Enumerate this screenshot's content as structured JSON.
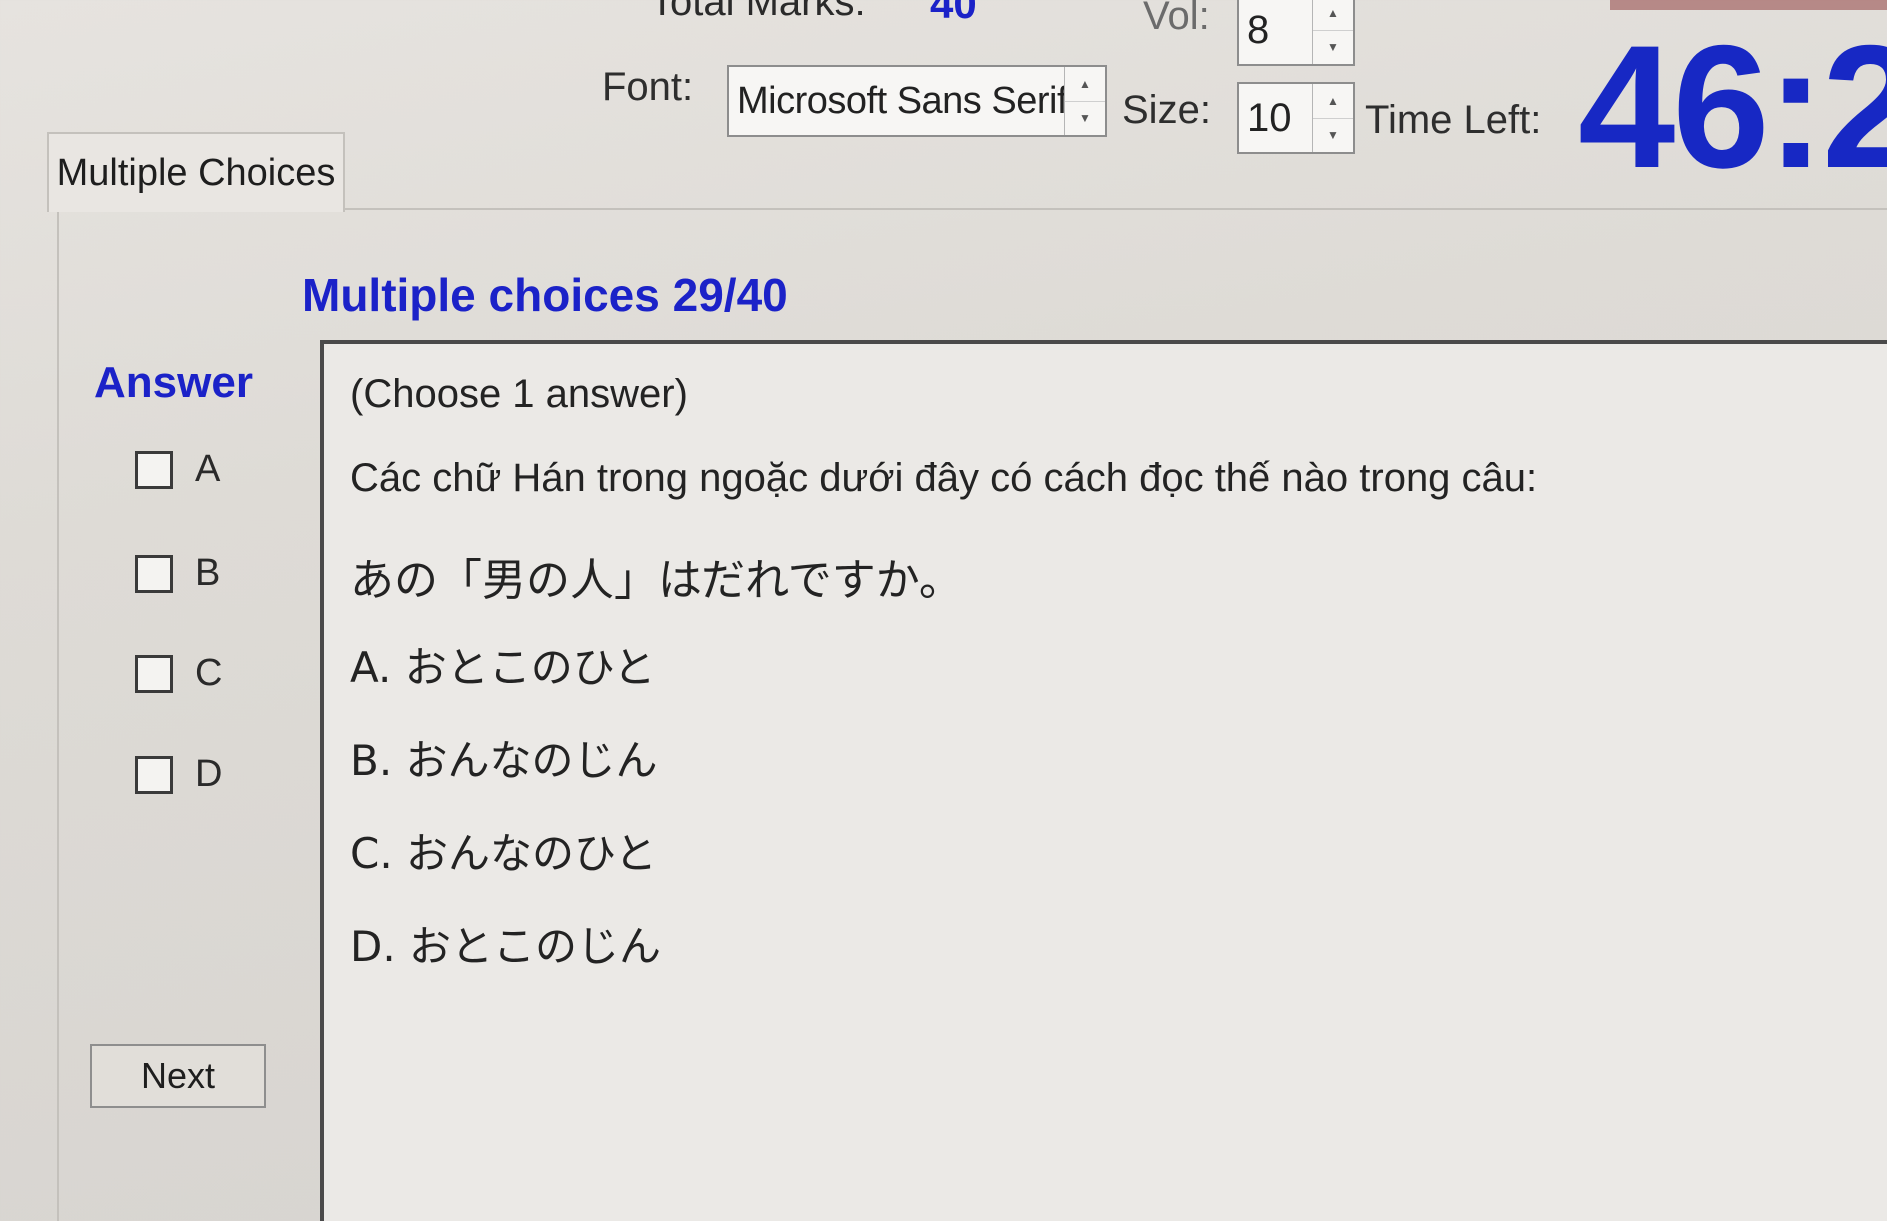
{
  "header": {
    "total_marks_label": "Total Marks:",
    "total_marks_value": "40",
    "vol_label": "Vol:",
    "vol_value": "8",
    "font_label": "Font:",
    "font_value": "Microsoft Sans Serif",
    "size_label": "Size:",
    "size_value": "10",
    "time_left_label": "Time Left:",
    "time_left_value": "46:2"
  },
  "tabs": [
    {
      "label": "Multiple Choices",
      "active": true
    }
  ],
  "question": {
    "progress": "Multiple choices 29/40",
    "instruction": "(Choose 1 answer)",
    "text": "Các chữ Hán trong ngoặc dưới đây có cách đọc thế nào trong câu:",
    "sentence": "あの「男の人」はだれですか。",
    "options": [
      "A. おとこのひと",
      "B. おんなのじん",
      "C. おんなのひと",
      "D. おとこのじん"
    ]
  },
  "answer": {
    "heading": "Answer",
    "choices": [
      {
        "letter": "A",
        "checked": false
      },
      {
        "letter": "B",
        "checked": false
      },
      {
        "letter": "C",
        "checked": false
      },
      {
        "letter": "D",
        "checked": false
      }
    ]
  },
  "buttons": {
    "next_label": "Next"
  },
  "colors": {
    "accent_blue": "#1b22c8",
    "timer_blue": "#1728c4",
    "background": "#dedbd6"
  },
  "icons": {
    "spin_up": "spin-up-arrow-icon",
    "spin_down": "spin-down-arrow-icon"
  }
}
